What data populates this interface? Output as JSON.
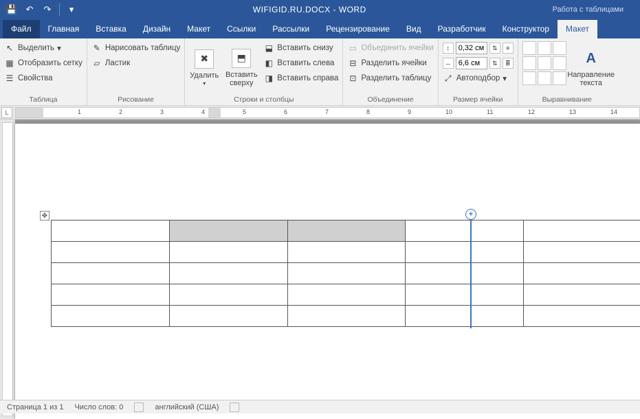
{
  "title": "WIFIGID.RU.DOCX - WORD",
  "tool_context": "Работа с таблицами",
  "qat": {
    "save": "💾",
    "undo": "↶",
    "redo": "↷",
    "custom": "▾"
  },
  "tabs": [
    "Файл",
    "Главная",
    "Вставка",
    "Дизайн",
    "Макет",
    "Ссылки",
    "Рассылки",
    "Рецензирование",
    "Вид",
    "Разработчик",
    "Конструктор",
    "Макет"
  ],
  "ribbon": {
    "table": {
      "label": "Таблица",
      "select": "Выделить",
      "grid": "Отобразить сетку",
      "props": "Свойства"
    },
    "draw": {
      "label": "Рисование",
      "draw": "Нарисовать таблицу",
      "eraser": "Ластик"
    },
    "rowscols": {
      "label": "Строки и столбцы",
      "delete": "Удалить",
      "insert_above": "Вставить сверху",
      "insert_below": "Вставить снизу",
      "insert_left": "Вставить слева",
      "insert_right": "Вставить справа"
    },
    "merge": {
      "label": "Объединение",
      "merge": "Объединить ячейки",
      "split": "Разделить ячейки",
      "split_table": "Разделить таблицу"
    },
    "cellsize": {
      "label": "Размер ячейки",
      "height": "0,32 см",
      "width": "6,6 см",
      "autofit": "Автоподбор"
    },
    "align": {
      "label": "Выравнивание",
      "textdir": "Направление текста"
    }
  },
  "ruler": {
    "numbers": [
      1,
      2,
      3,
      4,
      5,
      6,
      7,
      8,
      9,
      10,
      11,
      12,
      13,
      14
    ]
  },
  "table_grid": {
    "rows": 5,
    "cols": 5
  },
  "status": {
    "page": "Страница 1 из 1",
    "words": "Число слов: 0",
    "lang": "английский (США)"
  }
}
